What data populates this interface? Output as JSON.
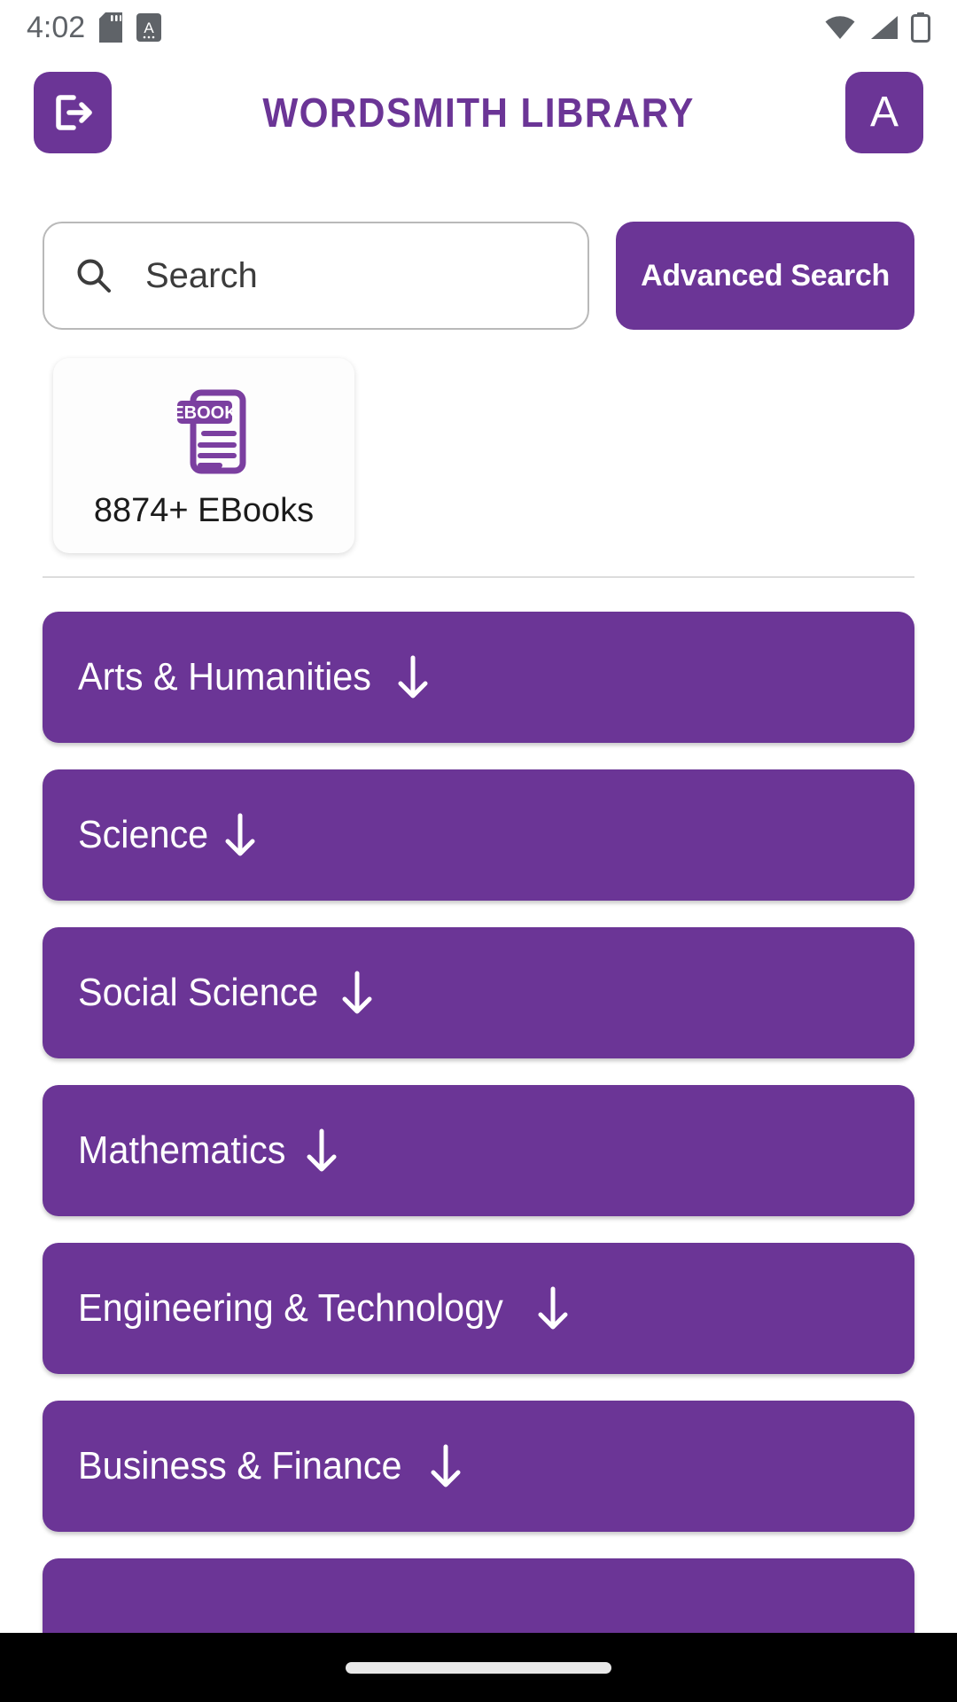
{
  "status_bar": {
    "time": "4:02",
    "icons_left": [
      "sd-card-icon",
      "font-size-a-icon"
    ],
    "icons_right": [
      "wifi-icon",
      "cellular-signal-icon",
      "battery-icon"
    ]
  },
  "header": {
    "logout_icon": "logout-icon",
    "title": "WORDSMITH LIBRARY",
    "avatar_letter": "A"
  },
  "search": {
    "icon": "search-icon",
    "placeholder": "Search",
    "value": "",
    "advanced_label": "Advanced Search"
  },
  "stats": [
    {
      "icon": "ebook-document-icon",
      "badge_text": "EBOOK",
      "label": "8874+ EBooks"
    }
  ],
  "categories": [
    {
      "label": "Arts & Humanities",
      "expand_icon": "arrow-down-icon"
    },
    {
      "label": "Science",
      "expand_icon": "arrow-down-icon"
    },
    {
      "label": "Social Science",
      "expand_icon": "arrow-down-icon"
    },
    {
      "label": "Mathematics",
      "expand_icon": "arrow-down-icon"
    },
    {
      "label": "Engineering & Technology",
      "expand_icon": "arrow-down-icon"
    },
    {
      "label": "Business & Finance",
      "expand_icon": "arrow-down-icon"
    },
    {
      "label": "",
      "expand_icon": "arrow-down-icon"
    }
  ],
  "nav_bar": {
    "home_indicator": "home-indicator-pill"
  },
  "colors": {
    "brand_purple": "#6B3596",
    "title_purple": "#6B3596",
    "text_dark": "#1b1b1b",
    "status_gray": "#5f6368",
    "divider_gray": "#dcdcdc",
    "nav_black": "#000000"
  }
}
